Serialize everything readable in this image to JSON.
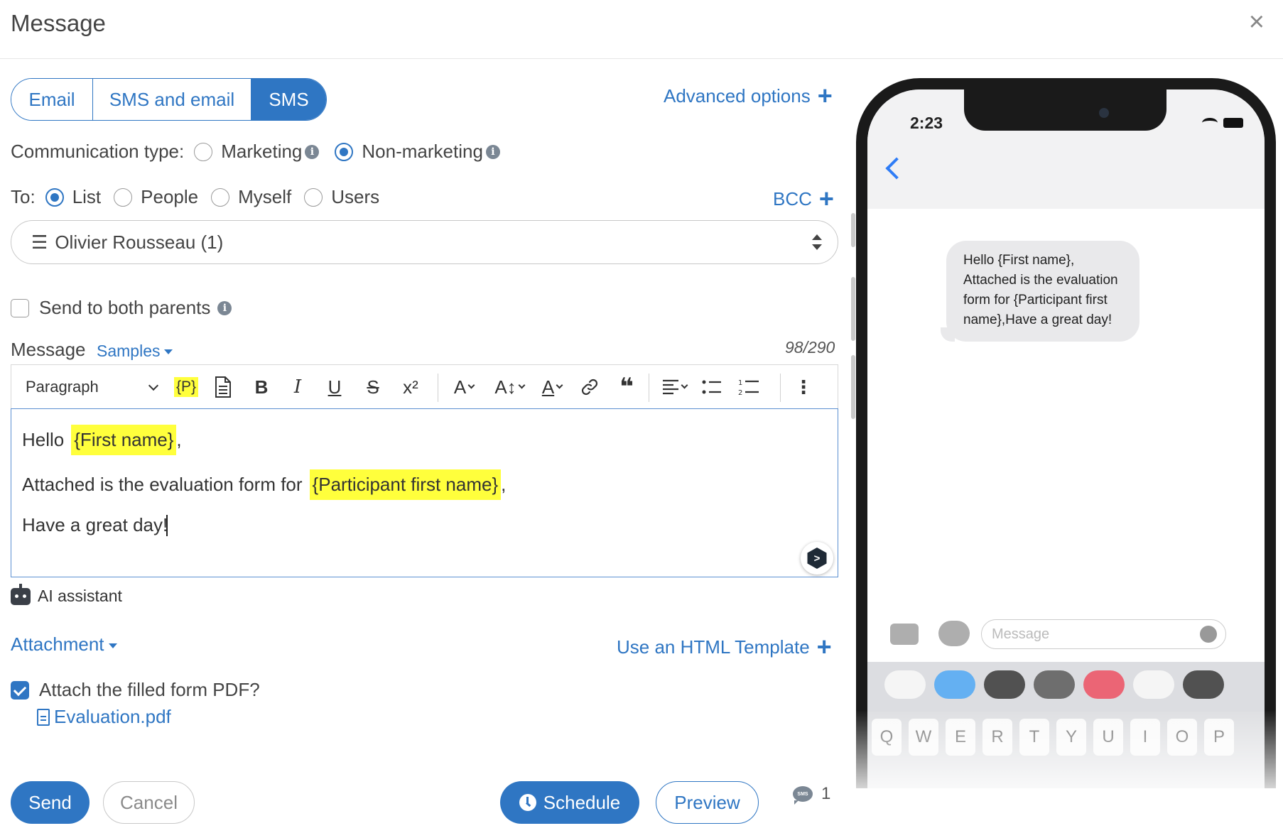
{
  "header": {
    "title": "Message",
    "close": "×"
  },
  "tabs": [
    {
      "label": "Email",
      "active": false
    },
    {
      "label": "SMS and email",
      "active": false
    },
    {
      "label": "SMS",
      "active": true
    }
  ],
  "advanced_options": "Advanced options",
  "communication": {
    "label": "Communication type:",
    "options": [
      {
        "label": "Marketing",
        "selected": false
      },
      {
        "label": "Non-marketing",
        "selected": true
      }
    ]
  },
  "to": {
    "label": "To:",
    "options": [
      {
        "label": "List",
        "selected": true
      },
      {
        "label": "People",
        "selected": false
      },
      {
        "label": "Myself",
        "selected": false
      },
      {
        "label": "Users",
        "selected": false
      }
    ]
  },
  "bcc": "BCC",
  "recipient_select": {
    "value": "Olivier Rousseau (1)"
  },
  "send_both_parents": {
    "label": "Send to both parents",
    "checked": false
  },
  "message": {
    "label": "Message",
    "samples": "Samples",
    "char_count": "98/290"
  },
  "toolbar": {
    "paragraph": "Paragraph",
    "placeholder_tag": "{P}",
    "bold": "B",
    "italic": "I",
    "underline": "U",
    "strike": "S",
    "superscript": "x²",
    "font_family": "A",
    "font_size": "A↕",
    "font_color": "A",
    "quote": "❝",
    "more": "⋮"
  },
  "editor": {
    "line1_pre": "Hello",
    "line1_tag": "{First name}",
    "line1_post": ",",
    "line2_pre": "Attached is the evaluation form for",
    "line2_tag": "{Participant first name}",
    "line2_post": ",",
    "line3": "Have a great day!"
  },
  "ai_assistant": "AI assistant",
  "attachment": "Attachment",
  "html_template": "Use an HTML Template",
  "attach_pdf": {
    "label": "Attach the filled form PDF?",
    "checked": true
  },
  "pdf_file": "Evaluation.pdf",
  "buttons": {
    "send": "Send",
    "cancel": "Cancel",
    "schedule": "Schedule",
    "preview": "Preview"
  },
  "sms_count": "1",
  "phone": {
    "time": "2:23",
    "bubble_text": "Hello {First name}, Attached is the evaluation form for {Participant first name},Have a great day!",
    "message_placeholder": "Message",
    "keys": [
      "Q",
      "W",
      "E",
      "R",
      "T",
      "Y",
      "U",
      "I",
      "O",
      "P"
    ]
  },
  "colors": {
    "accent": "#2f76c3",
    "highlight": "#ffff3c",
    "ios_blue": "#2f7df6"
  }
}
